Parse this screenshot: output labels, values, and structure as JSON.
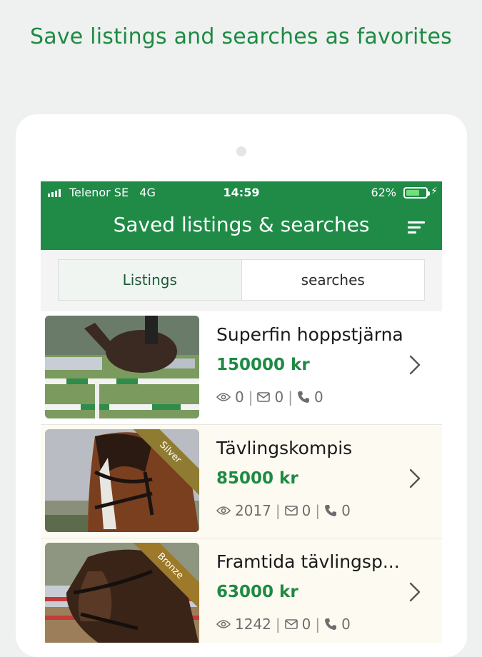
{
  "headline": "Save listings and searches as favorites",
  "status_bar": {
    "carrier": "Telenor SE   4G",
    "time": "14:59",
    "battery": "62%"
  },
  "app_bar": {
    "title": "Saved listings & searches"
  },
  "tabs": [
    {
      "label": "Listings",
      "active": true
    },
    {
      "label": "searches",
      "active": false
    }
  ],
  "listings": [
    {
      "title": "Superfin hoppstjärna",
      "price": "150000 kr",
      "views": "0",
      "messages": "0",
      "calls": "0",
      "badge": "",
      "bg": "#ffffff"
    },
    {
      "title": "Tävlingskompis",
      "price": "85000 kr",
      "views": "2017",
      "messages": "0",
      "calls": "0",
      "badge": "Silver",
      "badge_color": "#8f7c32",
      "bg": "#fdfbf1"
    },
    {
      "title": "Framtida tävlingsp...",
      "price": "63000 kr",
      "views": "1242",
      "messages": "0",
      "calls": "0",
      "badge": "Bronze",
      "badge_color": "#9c7a2a",
      "bg": "#fdfbf1"
    }
  ],
  "colors": {
    "brand": "#1f8b47",
    "price": "#1e8a43",
    "background": "#eef1ef"
  }
}
